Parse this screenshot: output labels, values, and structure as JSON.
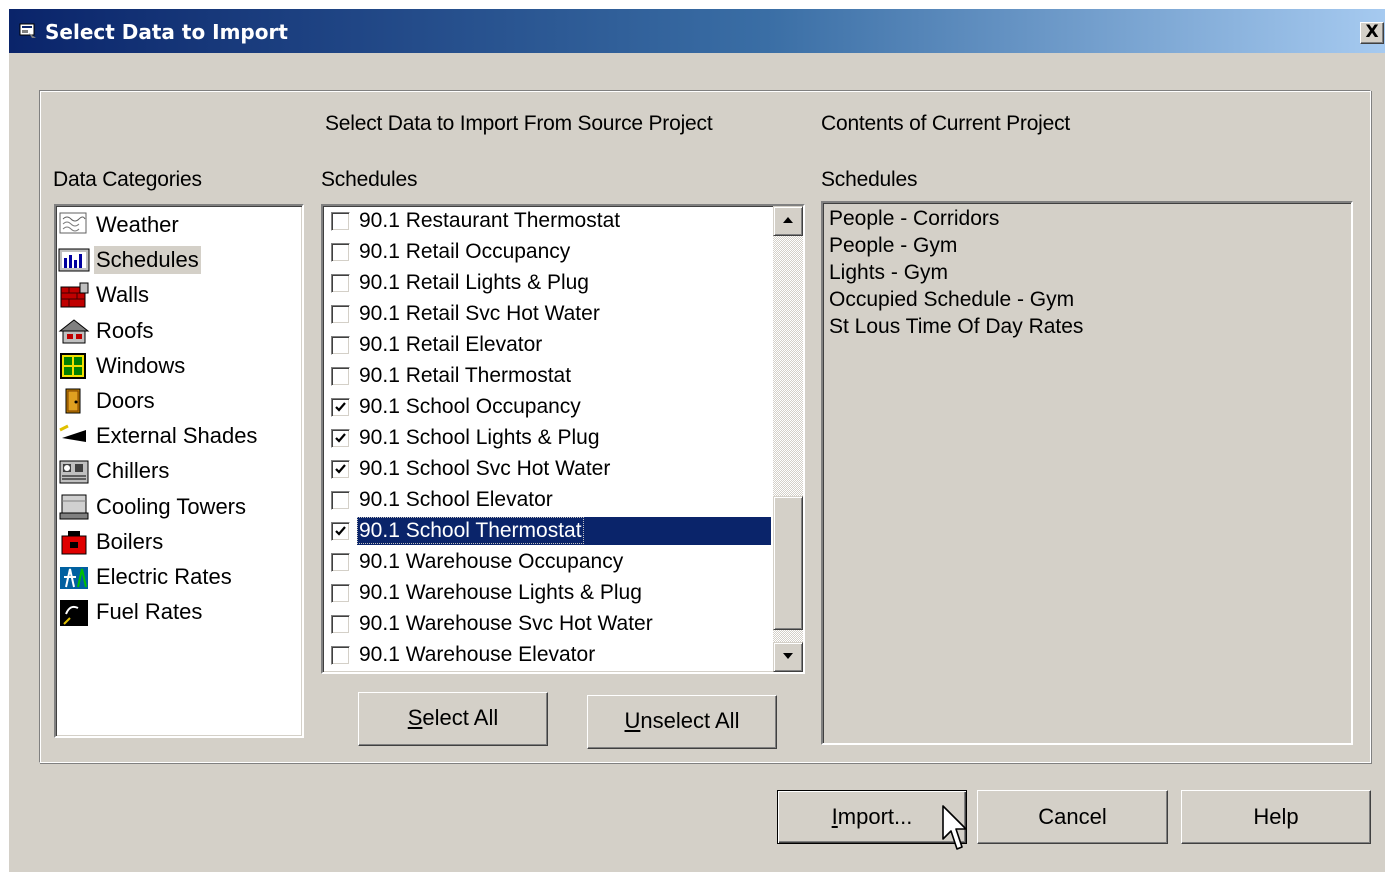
{
  "window": {
    "title": "Select Data to Import",
    "close_label": "X"
  },
  "headers": {
    "source_heading": "Select Data to Import From Source Project",
    "current_heading": "Contents of Current Project",
    "categories_label": "Data Categories",
    "source_list_label": "Schedules",
    "current_list_label": "Schedules"
  },
  "categories": [
    {
      "label": "Weather",
      "icon": "weather-icon"
    },
    {
      "label": "Schedules",
      "icon": "schedules-icon",
      "selected": true
    },
    {
      "label": "Walls",
      "icon": "walls-icon"
    },
    {
      "label": "Roofs",
      "icon": "roofs-icon"
    },
    {
      "label": "Windows",
      "icon": "windows-icon"
    },
    {
      "label": "Doors",
      "icon": "doors-icon"
    },
    {
      "label": "External Shades",
      "icon": "external-shades-icon"
    },
    {
      "label": "Chillers",
      "icon": "chillers-icon"
    },
    {
      "label": "Cooling Towers",
      "icon": "cooling-towers-icon"
    },
    {
      "label": "Boilers",
      "icon": "boilers-icon"
    },
    {
      "label": "Electric Rates",
      "icon": "electric-rates-icon"
    },
    {
      "label": "Fuel Rates",
      "icon": "fuel-rates-icon"
    }
  ],
  "schedules": [
    {
      "label": "90.1 Restaurant Thermostat",
      "checked": false
    },
    {
      "label": "90.1 Retail Occupancy",
      "checked": false
    },
    {
      "label": "90.1 Retail Lights & Plug",
      "checked": false
    },
    {
      "label": "90.1 Retail Svc Hot Water",
      "checked": false
    },
    {
      "label": "90.1 Retail Elevator",
      "checked": false
    },
    {
      "label": "90.1 Retail Thermostat",
      "checked": false
    },
    {
      "label": "90.1 School Occupancy",
      "checked": true
    },
    {
      "label": "90.1 School Lights & Plug",
      "checked": true
    },
    {
      "label": "90.1 School Svc Hot Water",
      "checked": true
    },
    {
      "label": "90.1 School Elevator",
      "checked": false
    },
    {
      "label": "90.1 School Thermostat",
      "checked": true,
      "selected": true
    },
    {
      "label": "90.1 Warehouse Occupancy",
      "checked": false
    },
    {
      "label": "90.1 Warehouse Lights & Plug",
      "checked": false
    },
    {
      "label": "90.1 Warehouse Svc Hot Water",
      "checked": false
    },
    {
      "label": "90.1 Warehouse Elevator",
      "checked": false
    }
  ],
  "current_project": [
    "People - Corridors",
    "People - Gym",
    "Lights - Gym",
    "Occupied Schedule - Gym",
    "St Lous Time Of Day Rates"
  ],
  "buttons": {
    "select_all": {
      "mnemonic": "S",
      "rest": "elect All"
    },
    "unselect_all": {
      "mnemonic": "U",
      "rest": "nselect All"
    },
    "import": {
      "mnemonic": "I",
      "rest": "mport..."
    },
    "cancel": "Cancel",
    "help": "Help"
  }
}
